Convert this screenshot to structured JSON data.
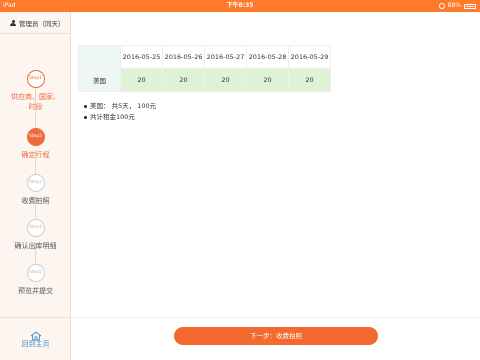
{
  "status_bar": {
    "device": "iPad",
    "time": "下午8:35",
    "battery": "88%"
  },
  "sidebar": {
    "user": "管理员（同天）",
    "steps": [
      {
        "badge": "Step1",
        "label_lines": [
          "供应商、国家、",
          "时段"
        ],
        "state": "done"
      },
      {
        "badge": "Step2",
        "label_lines": [
          "确定行程"
        ],
        "state": "active"
      },
      {
        "badge": "Step3",
        "label_lines": [
          "收费拍照"
        ],
        "state": "todo"
      },
      {
        "badge": "Step4",
        "label_lines": [
          "确认出库明细"
        ],
        "state": "todo"
      },
      {
        "badge": "Step5",
        "label_lines": [
          "预览并提交"
        ],
        "state": "todo"
      }
    ],
    "home": {
      "label": "回到主页",
      "icon": "home-icon"
    }
  },
  "table": {
    "dates": [
      "2016-05-25",
      "2016-05-26",
      "2016-05-27",
      "2016-05-28",
      "2016-05-29"
    ],
    "rows": [
      {
        "name": "美国",
        "values": [
          "20",
          "20",
          "20",
          "20",
          "20"
        ]
      }
    ]
  },
  "summary": [
    "美国： 共5天， 100元",
    "共计租金100元"
  ],
  "next_button": "下一步：收费拍照",
  "colors": {
    "accent": "#f26a2e",
    "status_bar": "#ff7a2a",
    "cell_green": "#def2d6",
    "header_teal": "#eef6f6",
    "home_blue": "#4a90c8"
  }
}
